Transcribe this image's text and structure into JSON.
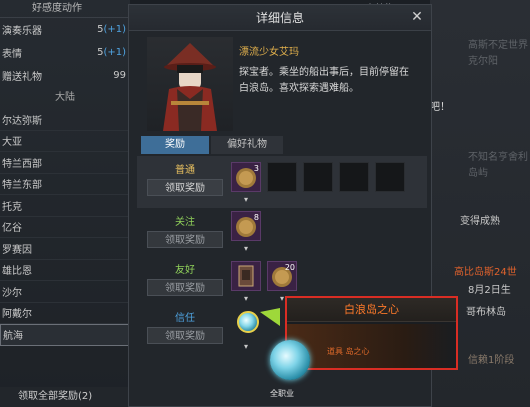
{
  "left": {
    "header": "好感度动作",
    "rows": [
      {
        "label": "演奏乐器",
        "count": "5",
        "plus": "(+1)"
      },
      {
        "label": "表情",
        "count": "5",
        "plus": "(+1)"
      },
      {
        "label": "赠送礼物",
        "count": "99",
        "plus": ""
      }
    ],
    "section": "大陆",
    "regions": [
      "尔达弥斯",
      "大亚",
      "特兰西部",
      "特兰东部",
      "托克",
      "亿谷",
      "罗赛因",
      "雄比恩",
      "沙尔",
      "阿戴尔",
      "航海"
    ],
    "footer": "领取全部奖励(2)"
  },
  "top_tab": "大航海",
  "right_ghost": [
    "高斯不定世界",
    "克尔阳",
    "吧！",
    "不知名亨舍利",
    "岛屿",
    "变得成熟"
  ],
  "side_info": {
    "name_line": "高比岛斯24世",
    "birthday": "8月2日生",
    "owner": "哥布林岛",
    "stage": "信赖1阶段"
  },
  "modal": {
    "title": "详细信息",
    "close": "✕",
    "char_name": "漂流少女艾玛",
    "desc": "探宝者。乘坐的船出事后，目前停留在白浪岛。喜欢探索遇难船。",
    "tabs": [
      "奖励",
      "偏好礼物"
    ],
    "tiers": [
      {
        "name": "普通",
        "color": "#e8c060",
        "button": "领取奖励",
        "enabled": true,
        "slots": [
          {
            "num": "3"
          }
        ]
      },
      {
        "name": "关注",
        "color": "#8fd05a",
        "button": "领取奖励",
        "enabled": false,
        "slots": [
          {
            "num": "8"
          }
        ]
      },
      {
        "name": "友好",
        "color": "#8fd05a",
        "button": "领取奖励",
        "enabled": false,
        "slots": [
          {
            "num": ""
          },
          {
            "num": "20"
          }
        ]
      },
      {
        "name": "信任",
        "color": "#4fa3e0",
        "button": "领取奖励",
        "enabled": false,
        "slots": []
      }
    ]
  },
  "tooltip": {
    "title": "白浪岛之心",
    "type": "道具 岛之心",
    "class": "全职业"
  }
}
